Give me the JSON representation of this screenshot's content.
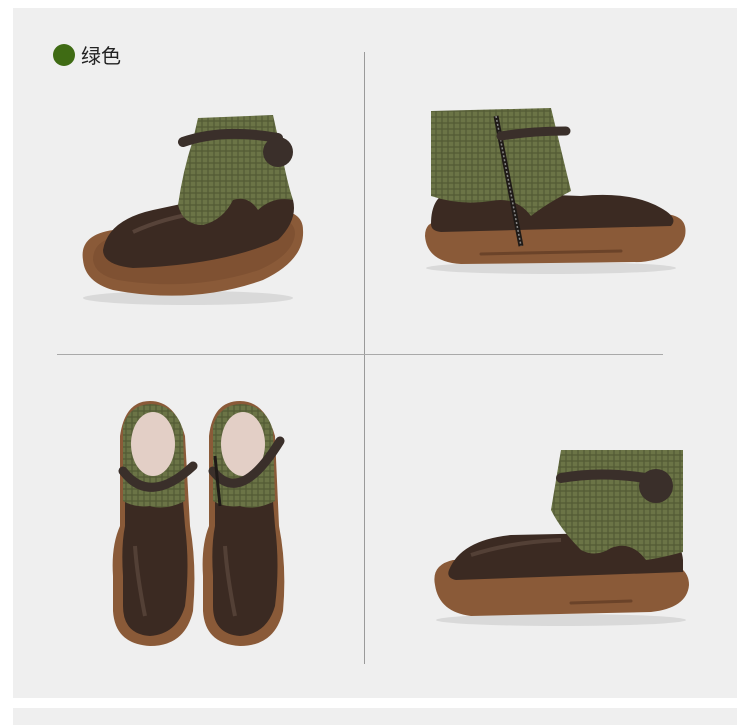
{
  "color_label": {
    "text": "绿色"
  },
  "colors": {
    "label_dot": "#3f6b14",
    "panel_bg": "#efefef",
    "knit": "#6b7446",
    "knit_dark": "#535a34",
    "leather": "#3b2a22",
    "leather_hi": "#6b5549",
    "sole": "#8a5a38",
    "sole_dark": "#6b4329",
    "lining": "#e3cfc6",
    "strap": "#3a2f2a"
  },
  "views": [
    {
      "name": "front-three-quarter-view"
    },
    {
      "name": "side-view-zipper"
    },
    {
      "name": "top-pair-view"
    },
    {
      "name": "side-view-button"
    }
  ]
}
